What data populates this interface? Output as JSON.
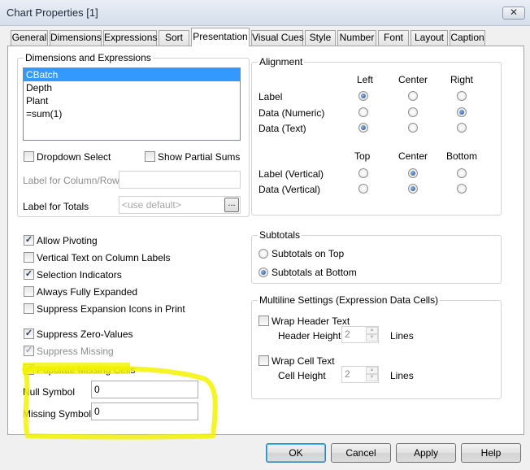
{
  "window": {
    "title": "Chart Properties [1]",
    "close_glyph": "✕"
  },
  "tabs": [
    {
      "label": "General"
    },
    {
      "label": "Dimensions"
    },
    {
      "label": "Expressions"
    },
    {
      "label": "Sort"
    },
    {
      "label": "Presentation"
    },
    {
      "label": "Visual Cues"
    },
    {
      "label": "Style"
    },
    {
      "label": "Number"
    },
    {
      "label": "Font"
    },
    {
      "label": "Layout"
    },
    {
      "label": "Caption"
    }
  ],
  "active_tab": "Presentation",
  "dims_group": {
    "title": "Dimensions and Expressions",
    "items": [
      {
        "label": "CBatch",
        "selected": true
      },
      {
        "label": "Depth",
        "selected": false
      },
      {
        "label": "Plant",
        "selected": false
      },
      {
        "label": "=sum(1)",
        "selected": false
      }
    ]
  },
  "options": {
    "dropdown_select": {
      "label": "Dropdown Select",
      "checked": false
    },
    "show_partial_sums": {
      "label": "Show Partial Sums",
      "checked": false
    },
    "label_col_row": {
      "label": "Label for Column/Row",
      "value": ""
    },
    "label_totals": {
      "label": "Label for Totals",
      "placeholder": "<use default>",
      "button": "..."
    }
  },
  "alignment": {
    "title": "Alignment",
    "cols_top": [
      "Left",
      "Center",
      "Right"
    ],
    "rows_top": [
      {
        "label": "Label",
        "selected": 0
      },
      {
        "label": "Data (Numeric)",
        "selected": 2
      },
      {
        "label": "Data (Text)",
        "selected": 0
      }
    ],
    "cols_bottom": [
      "Top",
      "Center",
      "Bottom"
    ],
    "rows_bottom": [
      {
        "label": "Label (Vertical)",
        "selected": 1
      },
      {
        "label": "Data (Vertical)",
        "selected": 1
      }
    ]
  },
  "checkboxes": [
    {
      "label": "Allow Pivoting",
      "checked": true,
      "enabled": true
    },
    {
      "label": "Vertical Text on Column Labels",
      "checked": false,
      "enabled": true
    },
    {
      "label": "Selection Indicators",
      "checked": true,
      "enabled": true
    },
    {
      "label": "Always Fully Expanded",
      "checked": false,
      "enabled": true
    },
    {
      "label": "Suppress Expansion Icons in Print",
      "checked": false,
      "enabled": true
    },
    {
      "label": "Suppress Zero-Values",
      "checked": true,
      "enabled": true
    },
    {
      "label": "Suppress Missing",
      "checked": true,
      "enabled": false
    },
    {
      "label": "Populate Missing Cells",
      "checked": true,
      "enabled": true
    }
  ],
  "symbols": {
    "null_symbol": {
      "label": "Null Symbol",
      "value": "0"
    },
    "missing_symbol": {
      "label": "Missing Symbol",
      "value": "0"
    }
  },
  "subtotals": {
    "title": "Subtotals",
    "options": [
      {
        "label": "Subtotals on Top",
        "selected": false
      },
      {
        "label": "Subtotals at Bottom",
        "selected": true
      }
    ]
  },
  "multiline": {
    "title": "Multiline Settings (Expression Data Cells)",
    "wrap_header": {
      "label": "Wrap Header Text",
      "checked": false,
      "height_label": "Header Height",
      "height_value": "2",
      "unit": "Lines"
    },
    "wrap_cell": {
      "label": "Wrap Cell Text",
      "checked": false,
      "height_label": "Cell Height",
      "height_value": "2",
      "unit": "Lines"
    }
  },
  "buttons": {
    "ok": "OK",
    "cancel": "Cancel",
    "apply": "Apply",
    "help": "Help"
  },
  "annotation": {
    "color": "#f2f200"
  }
}
